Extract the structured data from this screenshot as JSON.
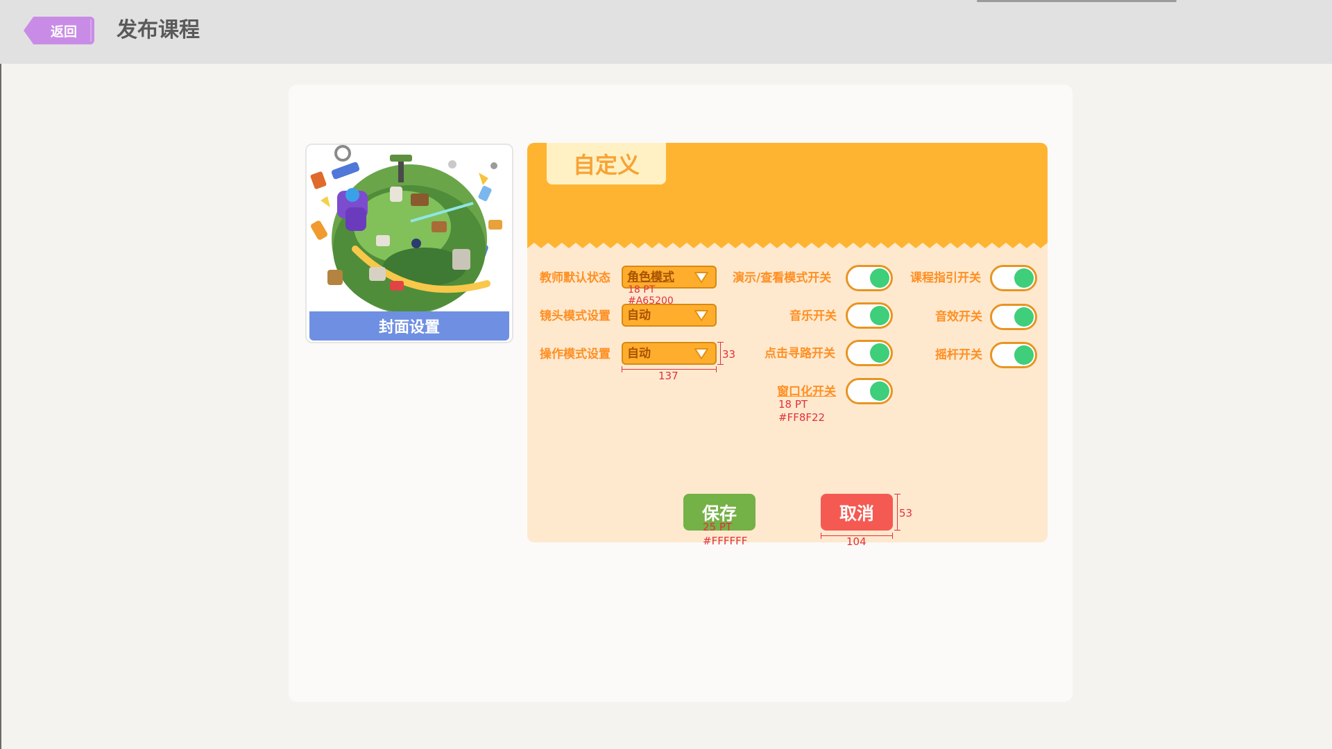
{
  "header": {
    "back_label": "返回",
    "title": "发布课程"
  },
  "cover": {
    "caption": "封面设置"
  },
  "panel": {
    "tab_label": "自定义"
  },
  "dropdowns": [
    {
      "label": "教师默认状态",
      "value": "角色模式"
    },
    {
      "label": "镜头模式设置",
      "value": "自动"
    },
    {
      "label": "操作模式设置",
      "value": "自动"
    }
  ],
  "toggles": [
    {
      "label": "演示/查看模式开关",
      "on": true
    },
    {
      "label": "音乐开关",
      "on": true
    },
    {
      "label": "点击寻路开关",
      "on": true
    },
    {
      "label": "窗口化开关",
      "on": true
    },
    {
      "label": "课程指引开关",
      "on": true
    },
    {
      "label": "音效开关",
      "on": true
    },
    {
      "label": "摇杆开关",
      "on": true
    }
  ],
  "actions": {
    "save_label": "保存",
    "cancel_label": "取消"
  },
  "annotations": {
    "dropdown_font_size": "18 PT",
    "dropdown_color": "#A65200",
    "dropdown_height": "33",
    "dropdown_width": "137",
    "label_font_size": "18 PT",
    "label_color": "#FF8F22",
    "button_font_size": "25 PT",
    "button_color": "#FFFFFF",
    "button_height": "53",
    "button_width": "104"
  },
  "colors": {
    "header_bg": "#e1e1e1",
    "accent_orange": "#ffb431",
    "label_orange": "#ff8f22",
    "dropdown_text": "#a65200",
    "toggle_green": "#3fce7a",
    "save_green": "#74b146",
    "cancel_red": "#f45a52",
    "cover_caption_blue": "#6f8fe2",
    "back_purple": "#c98ce6"
  }
}
